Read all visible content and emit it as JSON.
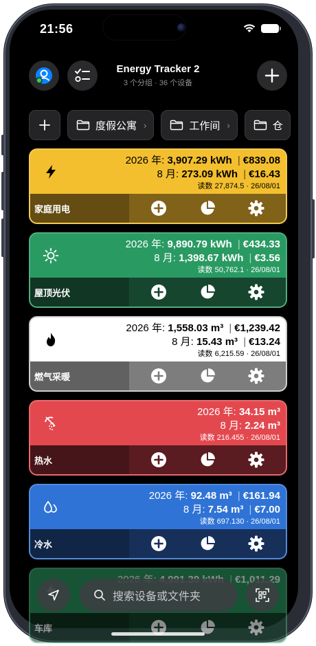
{
  "status_bar": {
    "time": "21:56"
  },
  "header": {
    "title": "Energy Tracker 2",
    "subtitle": "3 个分组 · 36 个设备",
    "icons": {
      "profile": "profile-icon",
      "checklist": "checklist-icon",
      "add": "plus-icon"
    }
  },
  "folders": [
    {
      "label": "度假公寓"
    },
    {
      "label": "工作间"
    },
    {
      "label": "仓"
    }
  ],
  "cards": [
    {
      "name": "家庭用电",
      "icon": "bolt-icon",
      "year_label": "2026 年:",
      "year_amount": "3,907.29 kWh",
      "year_cost": "€839.08",
      "month_label": "8 月:",
      "month_amount": "273.09 kWh",
      "month_cost": "€16.43",
      "reading": "读数 27,874.5 · 26/08/01",
      "color": "#f3bf2e",
      "bar_color": "#806219",
      "action_color": "#f3bf2e"
    },
    {
      "name": "屋顶光伏",
      "icon": "sun-icon",
      "year_label": "2026 年:",
      "year_amount": "9,890.79 kWh",
      "year_cost": "€434.33",
      "month_label": "8 月:",
      "month_amount": "1,398.67 kWh",
      "month_cost": "€3.56",
      "reading": "读数 50,762.1 · 26/08/01",
      "color": "#2a9a63",
      "bar_color": "#17462f",
      "action_color": "#2a9a63"
    },
    {
      "name": "燃气采暖",
      "icon": "flame-icon",
      "year_label": "2026 年:",
      "year_amount": "1,558.03 m³",
      "year_cost": "€1,239.42",
      "month_label": "8 月:",
      "month_amount": "15.43 m³",
      "month_cost": "€13.24",
      "reading": "读数 6,215.59 · 26/08/01",
      "color": "#ffffff",
      "bar_color": "#7d7d7d",
      "action_color": "#ffffff"
    },
    {
      "name": "热水",
      "icon": "shower-icon",
      "year_label": "2026 年:",
      "year_amount": "34.15 m³",
      "year_cost": "",
      "month_label": "8 月:",
      "month_amount": "2.24 m³",
      "month_cost": "",
      "reading": "读数 216.455 · 26/08/01",
      "color": "#e4484f",
      "bar_color": "#5a1c20",
      "action_color": "#e4484f"
    },
    {
      "name": "冷水",
      "icon": "drops-icon",
      "year_label": "2026 年:",
      "year_amount": "92.48 m³",
      "year_cost": "€161.94",
      "month_label": "8 月:",
      "month_amount": "7.54 m³",
      "month_cost": "€7.00",
      "reading": "读数 697.130 · 26/08/01",
      "color": "#2f73d6",
      "bar_color": "#17305a",
      "action_color": "#2f73d6"
    },
    {
      "name": "车库",
      "icon": "bolt-icon",
      "year_label": "2026 年:",
      "year_amount": "4,991.39 kWh",
      "year_cost": "€1,011.29",
      "month_label": "",
      "month_amount": "",
      "month_cost": "",
      "reading": "",
      "color": "#2a9a63",
      "bar_color": "#17462f",
      "action_color": "#2a9a63"
    }
  ],
  "search": {
    "placeholder": "搜索设备或文件夹"
  }
}
